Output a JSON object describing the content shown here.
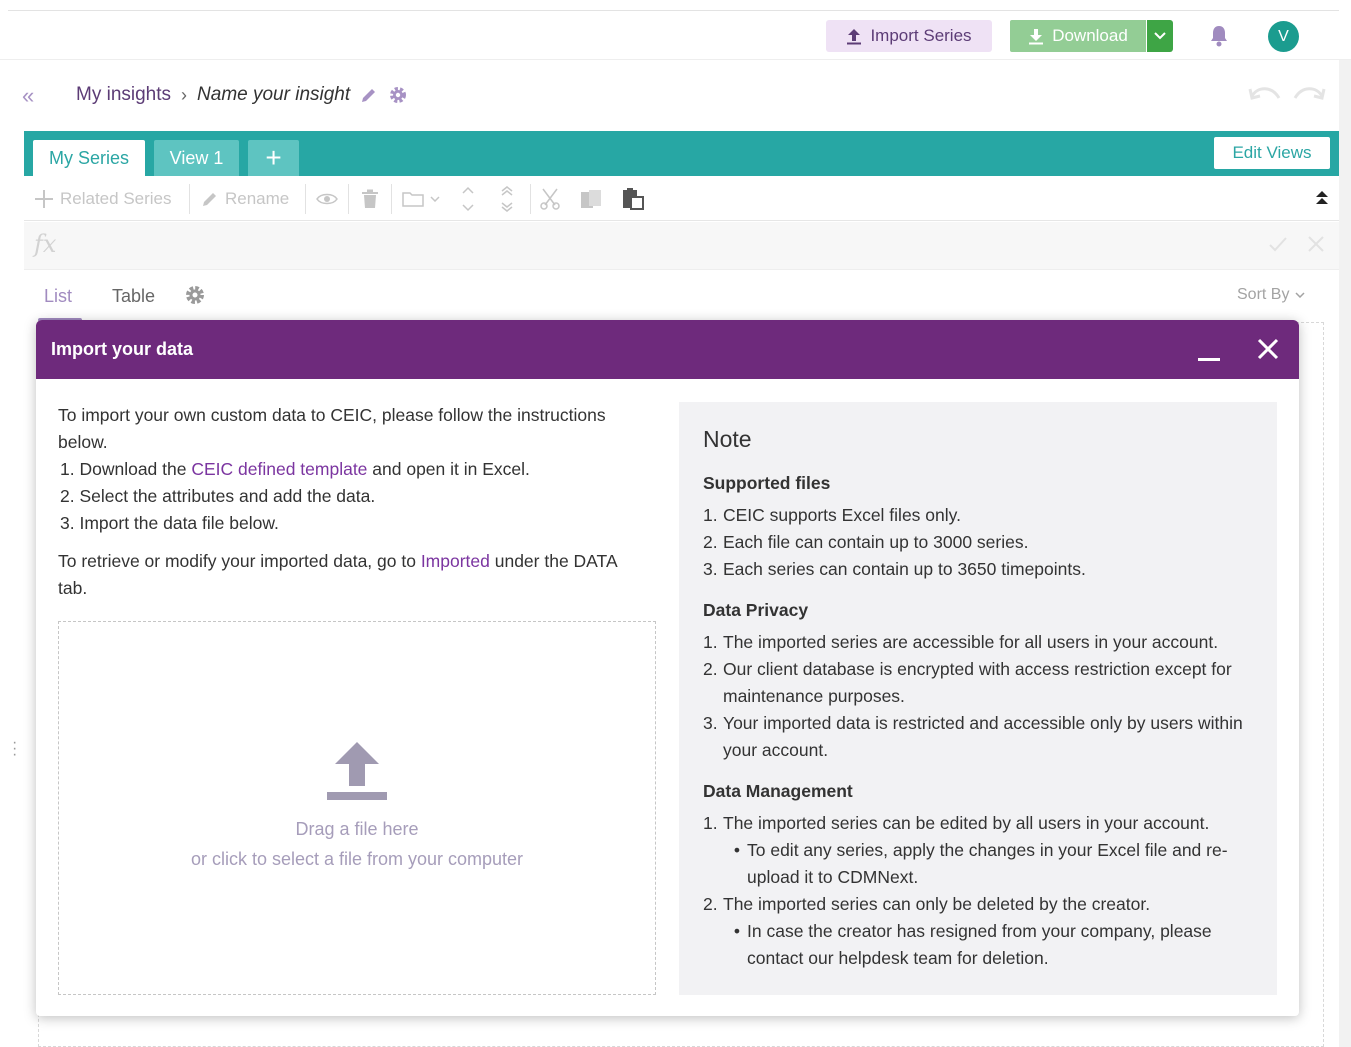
{
  "header": {
    "import_label": "Import Series",
    "download_label": "Download",
    "avatar_initial": "V"
  },
  "breadcrumb": {
    "root": "My insights",
    "separator": "›",
    "name": "Name your insight"
  },
  "tabs": {
    "my_series": "My Series",
    "view1": "View 1",
    "add": "+",
    "edit_views": "Edit Views"
  },
  "toolbar": {
    "related_series": "Related Series",
    "rename": "Rename"
  },
  "formula": {
    "fx": "fx"
  },
  "listbar": {
    "list": "List",
    "table": "Table",
    "sort_by": "Sort By"
  },
  "modal": {
    "title": "Import your data",
    "intro": {
      "p1": "To import your own custom data to CEIC, please follow the instructions below.",
      "s1_pre": "1. Download the ",
      "s1_link": "CEIC defined template",
      "s1_post": " and open it in Excel.",
      "s2": "2. Select the attributes and add the data.",
      "s3": "3. Import the data file below.",
      "p2_pre": "To retrieve or modify your imported data, go to ",
      "p2_link": "Imported",
      "p2_post": " under the DATA tab."
    },
    "dropzone": {
      "line1": "Drag a file here",
      "line2": "or click to select a file from your computer"
    },
    "note": {
      "title": "Note",
      "supported_title": "Supported files",
      "supported": [
        {
          "n": "1.",
          "t": "CEIC supports Excel files only."
        },
        {
          "n": "2.",
          "t": "Each file can contain up to 3000 series."
        },
        {
          "n": "3.",
          "t": "Each series can contain up to 3650 timepoints."
        }
      ],
      "privacy_title": "Data Privacy",
      "privacy": [
        {
          "n": "1.",
          "t": "The imported series are accessible for all users in your account."
        },
        {
          "n": "2.",
          "t": "Our client database is encrypted with access restriction except for maintenance purposes."
        },
        {
          "n": "3.",
          "t": "Your imported data is restricted and accessible only by users within your account."
        }
      ],
      "mgmt_title": "Data Management",
      "mgmt1_n": "1.",
      "mgmt1": "The imported series can be edited by all users in your account.",
      "mgmt1_b": "To edit any series, apply the changes in your Excel file and re-upload it to CDMNext.",
      "mgmt2_n": "2.",
      "mgmt2": "The imported series can only be deleted by the creator.",
      "mgmt2_b": "In case the creator has resigned from your company, please contact our helpdesk team for deletion."
    }
  }
}
